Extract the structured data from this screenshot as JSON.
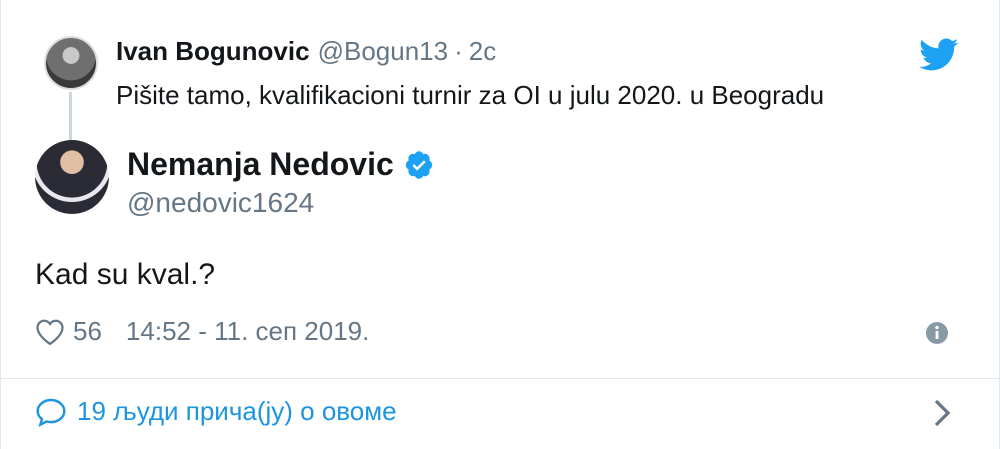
{
  "parent_tweet": {
    "name": "Ivan Bogunovic",
    "handle": "@Bogun13",
    "separator": "·",
    "time": "2c",
    "text": "Pišite tamo, kvalifikacioni turnir za OI u julu 2020. u Beogradu"
  },
  "main_tweet": {
    "name": "Nemanja Nedovic",
    "verified": true,
    "handle": "@nedovic1624",
    "text": "Kad su kval.?",
    "like_count": "56",
    "timestamp": "14:52 - 11. сеп 2019."
  },
  "footer": {
    "conversation_label": "19 људи прича(ју) о овоме"
  },
  "icons": {
    "brand": "twitter-bird-icon",
    "verified": "verified-badge-icon",
    "like": "heart-icon",
    "info": "info-icon",
    "reply": "speech-bubble-icon",
    "chevron": "chevron-right-icon"
  },
  "colors": {
    "brand_blue": "#1da1f2",
    "link_blue": "#1b95e0",
    "secondary_text": "#657786",
    "primary_text": "#14171a",
    "border": "#e1e8ed"
  }
}
